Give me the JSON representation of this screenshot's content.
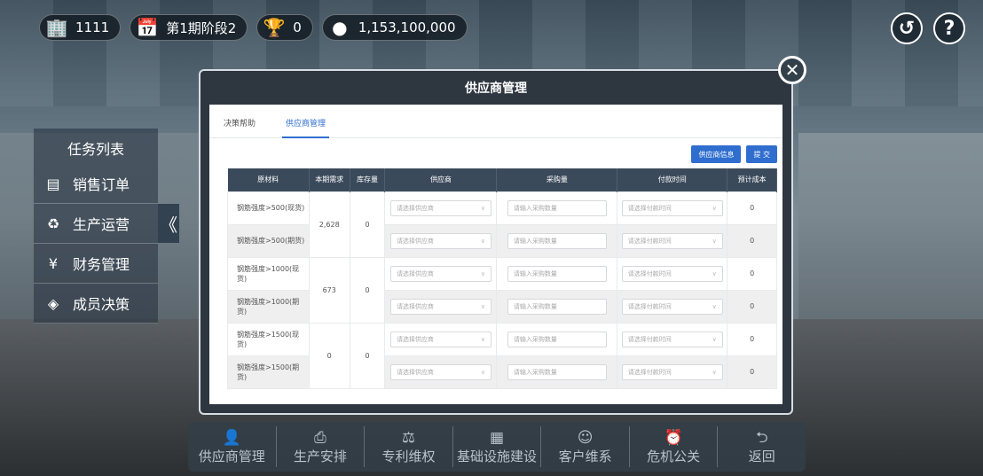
{
  "topbar": {
    "player_id": "1111",
    "period": "第1期阶段2",
    "trophies": "0",
    "money": "1,153,100,000"
  },
  "icons": {
    "player": "building-icon",
    "period": "calendar-icon",
    "trophy": "trophy-icon",
    "money": "coin-icon",
    "history": "history-icon",
    "help": "help-icon"
  },
  "task_panel": {
    "title": "任务列表",
    "items": [
      {
        "label": "销售订单",
        "icon": "document-icon"
      },
      {
        "label": "生产运营",
        "icon": "recycle-icon"
      },
      {
        "label": "财务管理",
        "icon": "yen-icon"
      },
      {
        "label": "成员决策",
        "icon": "layers-icon"
      }
    ],
    "collapse": "《"
  },
  "modal": {
    "title": "供应商管理",
    "tabs": [
      "决策帮助",
      "供应商管理"
    ],
    "active_tab": "供应商管理",
    "buttons": {
      "info": "供应商信息",
      "submit": "提 交"
    },
    "table": {
      "headers": [
        "原材料",
        "本期需求",
        "库存量",
        "供应商",
        "采购量",
        "付款时间",
        "预计成本"
      ],
      "placeholders": {
        "supplier": "请选择供应商",
        "quantity": "请输入采购数量",
        "pay_time": "请选择付款时间"
      },
      "groups": [
        {
          "demand": "2,628",
          "stock": "0",
          "rows": [
            {
              "material": "钢筋强度>500(现货)",
              "cost": "0"
            },
            {
              "material": "钢筋强度>500(期货)",
              "cost": "0"
            }
          ]
        },
        {
          "demand": "673",
          "stock": "0",
          "rows": [
            {
              "material": "钢筋强度>1000(现货)",
              "cost": "0"
            },
            {
              "material": "钢筋强度>1000(期货)",
              "cost": "0"
            }
          ]
        },
        {
          "demand": "0",
          "stock": "0",
          "rows": [
            {
              "material": "钢筋强度>1500(现货)",
              "cost": "0"
            },
            {
              "material": "钢筋强度>1500(期货)",
              "cost": "0"
            }
          ]
        }
      ]
    }
  },
  "bottom_bar": {
    "items": [
      {
        "label": "供应商管理",
        "icon": "supplier-icon"
      },
      {
        "label": "生产安排",
        "icon": "printer-icon"
      },
      {
        "label": "专利维权",
        "icon": "patent-icon"
      },
      {
        "label": "基础设施建设",
        "icon": "building-plan-icon"
      },
      {
        "label": "客户维系",
        "icon": "user-icon"
      },
      {
        "label": "危机公关",
        "icon": "alarm-icon"
      },
      {
        "label": "返回",
        "icon": "back-icon"
      }
    ]
  }
}
